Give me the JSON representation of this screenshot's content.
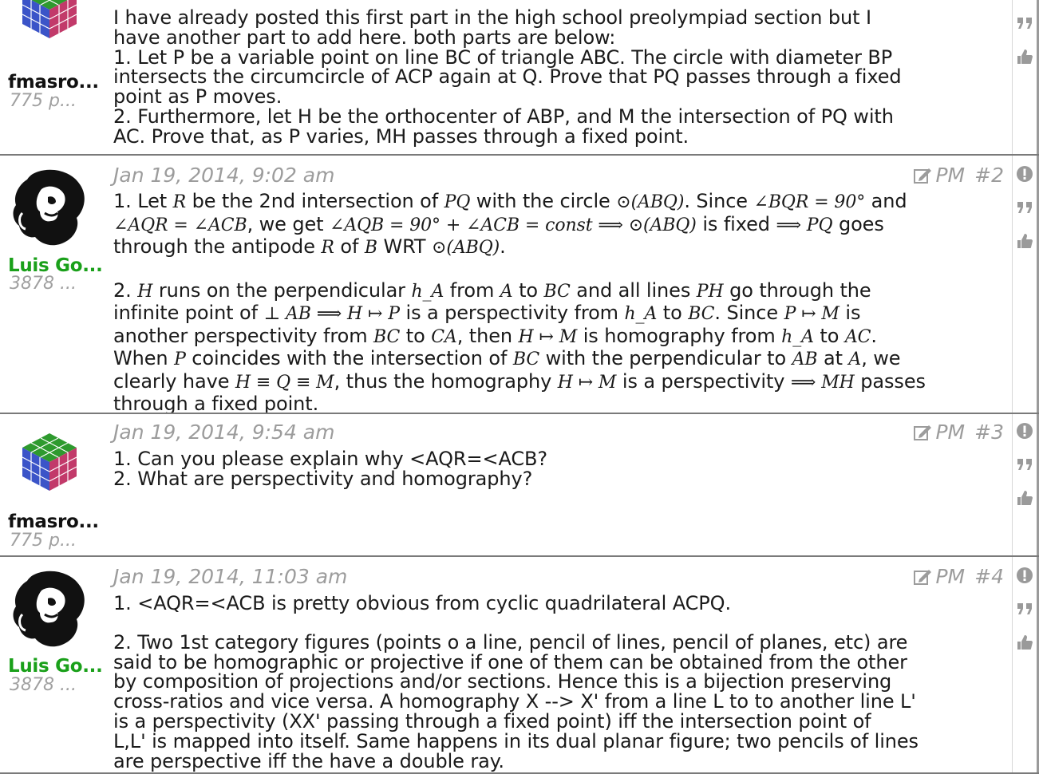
{
  "posts": [
    {
      "username": "fmasro...",
      "post_count": "775 p...",
      "avatar_icon": "cube-avatar-icon",
      "body": [
        "I have already posted this first part in the high school preolympiad section but I",
        "have another part to add here. both parts are below:",
        "1. Let P be a variable point on line BC of triangle ABC. The circle with diameter BP",
        "intersects the circumcircle of ACP again at Q. Prove that PQ passes through a fixed",
        "point as P moves.",
        "2. Furthermore, let H be the orthocenter of ABP, and M the intersection of PQ with",
        "AC. Prove that, as P varies, MH passes through a fixed point."
      ]
    },
    {
      "username": "Luis Go...",
      "post_count": "3878 ...",
      "avatar_icon": "sculpture-avatar-icon",
      "date": "Jan 19, 2014, 9:02 am",
      "pm_label": "PM",
      "post_number": "#2",
      "para1_line1": [
        "1. Let ",
        "R",
        " be the 2nd intersection of ",
        "PQ",
        " with the circle ",
        "⊙(ABQ)",
        ". Since ",
        "∠BQR = 90°",
        " and"
      ],
      "para1_line2": [
        "∠AQR = ∠ACB",
        ", we get ",
        "∠AQB = 90° + ∠ACB = const ⟹ ⊙(ABQ)",
        " is fixed ",
        "⟹ PQ",
        " goes"
      ],
      "para1_line3": [
        "through the antipode ",
        "R",
        " of ",
        "B",
        " WRT ",
        "⊙(ABQ)",
        "."
      ],
      "para2_line1": [
        "2. ",
        "H",
        " runs on the perpendicular ",
        "h_A",
        " from ",
        "A",
        " to ",
        "BC",
        " and all lines ",
        "PH",
        " go through the"
      ],
      "para2_line2": [
        "infinite point of ",
        "⊥ AB ⟹ H ↦ P",
        " is a perspectivity from ",
        "h_A",
        " to ",
        "BC",
        ". Since ",
        "P ↦ M",
        " is"
      ],
      "para2_line3": [
        "another perspectivity from ",
        "BC",
        " to ",
        "CA",
        ", then ",
        "H ↦ M",
        " is homography from ",
        "h_A",
        " to ",
        "AC",
        "."
      ],
      "para2_line4": [
        "When ",
        "P",
        " coincides with the intersection of ",
        "BC",
        " with the perpendicular to ",
        "AB",
        " at ",
        "A",
        ", we"
      ],
      "para2_line5": [
        "clearly have ",
        "H ≡ Q ≡ M",
        ", thus the homography ",
        "H ↦ M",
        " is a perspectivity ",
        "⟹ MH",
        " passes"
      ],
      "para2_line6": [
        "through a fixed point."
      ]
    },
    {
      "username": "fmasro...",
      "post_count": "775 p...",
      "avatar_icon": "cube-avatar-icon",
      "date": "Jan 19, 2014, 9:54 am",
      "pm_label": "PM",
      "post_number": "#3",
      "body": [
        "1. Can you please explain why <AQR=<ACB?",
        "2. What are perspectivity and homography?"
      ]
    },
    {
      "username": "Luis Go...",
      "post_count": "3878 ...",
      "avatar_icon": "sculpture-avatar-icon",
      "date": "Jan 19, 2014, 11:03 am",
      "pm_label": "PM",
      "post_number": "#4",
      "body_p1": "1. <AQR=<ACB is pretty obvious from cyclic quadrilateral ACPQ.",
      "body_p2": [
        "2. Two 1st category figures (points o a line, pencil of lines, pencil of planes, etc) are",
        "said to be homographic or projective if one of them can be obtained from the other",
        "by composition of projections and/or sections. Hence this is a bijection preserving",
        "cross-ratios and vice versa. A homography X --> X' from a line L to to another line L'",
        "is a perspectivity (XX' passing through a fixed point) iff the intersection point of",
        "L,L' is mapped into itself. Same happens in its dual planar figure; two pencils of lines",
        "are perspective iff the have a double ray."
      ]
    }
  ],
  "colors": {
    "username_black": "#111111",
    "username_green": "#1aa01a",
    "meta_gray": "#9c9c9c",
    "divider": "#7a7a7a"
  },
  "icons": {
    "report": "report-icon",
    "quote": "quote-icon",
    "like": "thumbs-up-icon",
    "pm": "edit-pm-icon"
  }
}
